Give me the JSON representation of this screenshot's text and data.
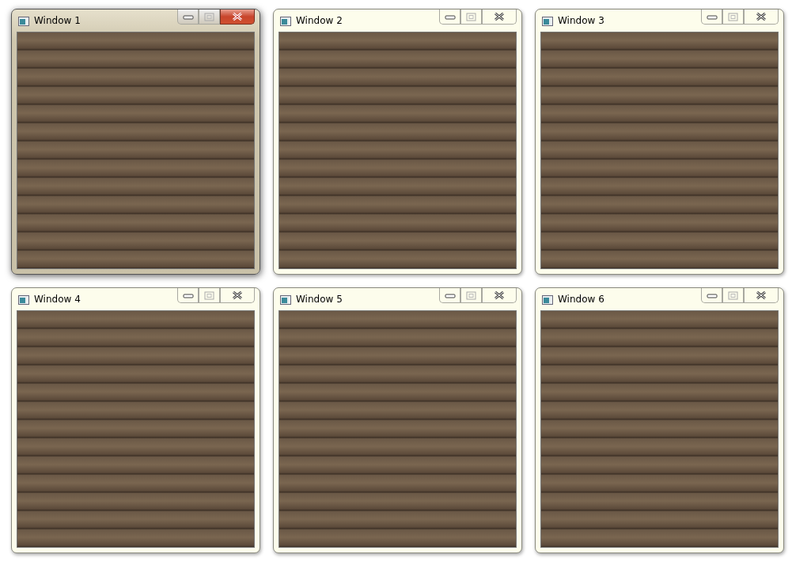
{
  "windows": [
    {
      "title": "Window 1",
      "active": true
    },
    {
      "title": "Window 2",
      "active": false
    },
    {
      "title": "Window 3",
      "active": false
    },
    {
      "title": "Window 4",
      "active": false
    },
    {
      "title": "Window 5",
      "active": false
    },
    {
      "title": "Window 6",
      "active": false
    }
  ]
}
